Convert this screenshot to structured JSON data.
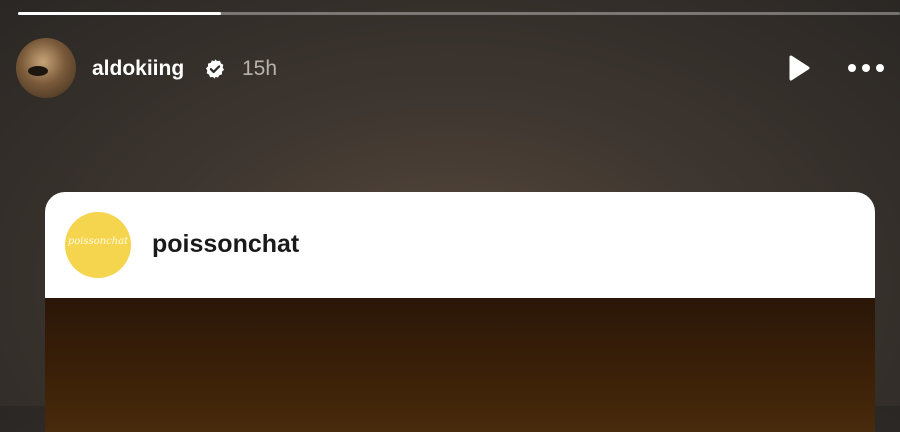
{
  "story": {
    "progress": 0.23,
    "author": {
      "username": "aldokiing",
      "verified": true,
      "time_ago": "15h",
      "avatar_icon": "honey-badger-avatar"
    },
    "controls": {
      "play_icon": "play-icon",
      "more_icon": "more-options-icon"
    },
    "shared_post": {
      "username": "poissonchat",
      "avatar_text": "poissonchat",
      "avatar_color": "#f5d44e"
    }
  }
}
